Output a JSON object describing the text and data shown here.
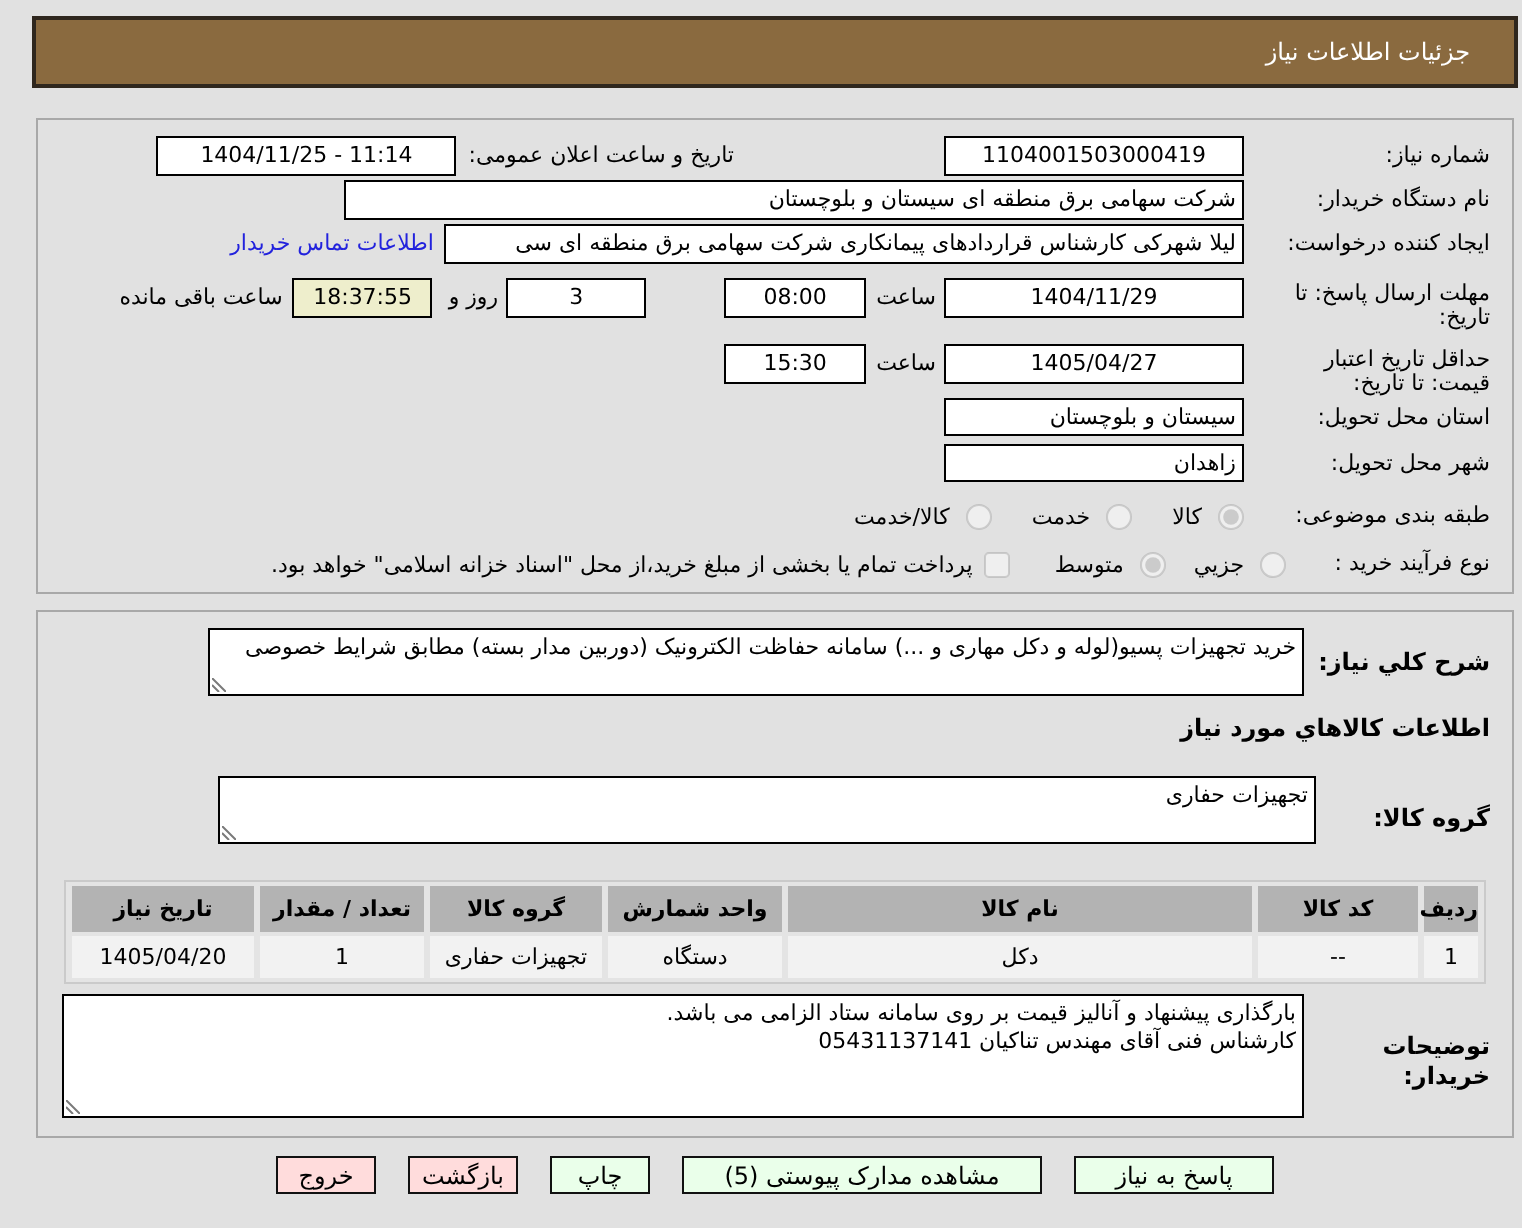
{
  "header": {
    "title": "جزئیات اطلاعات نیاز"
  },
  "request_info": {
    "need_number": {
      "label": "شماره نیاز:",
      "value": "1104001503000419"
    },
    "announcement": {
      "label": "تاریخ و ساعت اعلان عمومی:",
      "value": "1404/11/25 - 11:14"
    },
    "buyer_org": {
      "label": "نام دستگاه خریدار:",
      "value": "شرکت سهامی برق منطقه ای سیستان و بلوچستان"
    },
    "requester": {
      "label": "ایجاد کننده درخواست:",
      "value": "لیلا شهرکی کارشناس قراردادهای پیمانکاری شرکت سهامی برق منطقه ای سی",
      "link": "اطلاعات تماس خریدار"
    },
    "reply_deadline": {
      "label": "مهلت ارسال پاسخ: تا تاریخ:",
      "date": "1404/11/29",
      "time_label": "ساعت",
      "time": "08:00",
      "days": "3",
      "days_label": "روز و",
      "remaining": "18:37:55",
      "remaining_label": "ساعت باقی مانده"
    },
    "price_validity": {
      "label": "حداقل تاریخ اعتبار قیمت: تا تاریخ:",
      "date": "1405/04/27",
      "time_label": "ساعت",
      "time": "15:30"
    },
    "delivery_province": {
      "label": "استان محل تحویل:",
      "value": "سیستان و بلوچستان"
    },
    "delivery_city": {
      "label": "شهر محل تحویل:",
      "value": "زاهدان"
    },
    "subject_category": {
      "label": "طبقه بندی موضوعی:",
      "disabled": true,
      "options": [
        {
          "label": "کالا",
          "selected": true
        },
        {
          "label": "خدمت",
          "selected": false
        },
        {
          "label": "کالا/خدمت",
          "selected": false
        }
      ]
    },
    "purchase_process": {
      "label": "نوع فرآیند خرید :",
      "disabled": true,
      "options": [
        {
          "label": "جزیي",
          "selected": false
        },
        {
          "label": "متوسط",
          "selected": true
        }
      ],
      "treasury_option": {
        "label": "پرداخت تمام یا بخشی از مبلغ خرید،از محل \"اسناد خزانه اسلامی\" خواهد بود.",
        "checked": false
      }
    }
  },
  "goods_info": {
    "description": {
      "label": "شرح کلي نیاز:",
      "value": "خرید تجهیزات پسیو(لوله و دکل مهاری و ...) سامانه حفاظت الکترونیک (دوربین مدار بسته) مطابق شرایط خصوصی"
    },
    "section_title": "اطلاعات کالاهاي مورد نیاز",
    "goods_group": {
      "label": "گروه کالا:",
      "value": "تجهیزات حفاری"
    },
    "table": {
      "columns": [
        "ردیف",
        "کد کالا",
        "نام کالا",
        "واحد شمارش",
        "گروه کالا",
        "تعداد / مقدار",
        "تاریخ نیاز"
      ],
      "rows": [
        [
          "1",
          "--",
          "دکل",
          "دستگاه",
          "تجهیزات حفاری",
          "1",
          "1405/04/20"
        ]
      ]
    },
    "buyer_notes": {
      "label": "توضیحات خریدار:",
      "lines": [
        "بارگذاری پیشنهاد و آنالیز قیمت بر روی سامانه ستاد الزامی می باشد.",
        "کارشناس فنی آقای مهندس تناکیان 05431137141"
      ]
    }
  },
  "buttons": [
    {
      "label": "پاسخ به نیاز",
      "kind": "action"
    },
    {
      "label": "مشاهده مدارک پیوستی (5)",
      "kind": "action"
    },
    {
      "label": "چاپ",
      "kind": "action"
    },
    {
      "label": "بازگشت",
      "kind": "exit"
    },
    {
      "label": "خروج",
      "kind": "exit"
    }
  ]
}
